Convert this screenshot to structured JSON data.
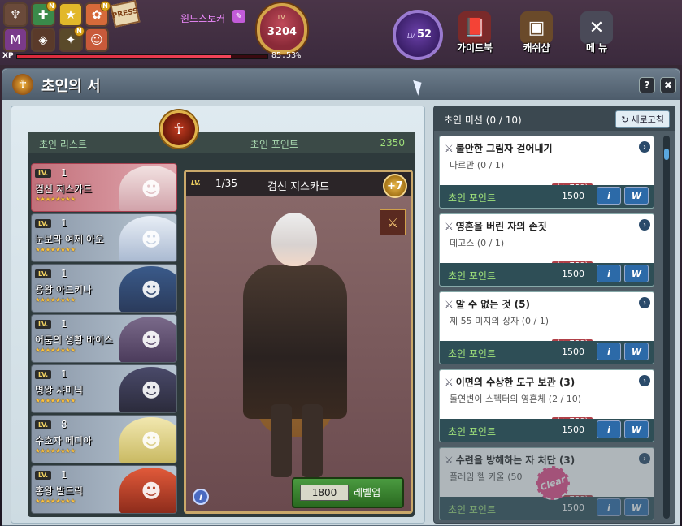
{
  "hud": {
    "character_name": "윈드스토커",
    "level_label": "LV.",
    "level_value": "3204",
    "xp_label": "XP",
    "xp_percent_text": "85.53%",
    "xp_fill": 0.8553,
    "press_label": "PRESS",
    "new_badge": "N",
    "account_level_label": "LV.",
    "account_level": "52",
    "menu": [
      {
        "label": "가이드북",
        "icon": "book-icon"
      },
      {
        "label": "캐쉬샵",
        "icon": "treasure-chest-icon"
      },
      {
        "label": "메 뉴",
        "icon": "crossed-tools-icon"
      }
    ]
  },
  "window": {
    "title": "초인의 서",
    "help_label": "?",
    "close_label": "✖"
  },
  "list": {
    "header_list": "초인 리스트",
    "header_points": "초인 포인트",
    "points_value": "2350",
    "lv_tag": "LV.",
    "stars": "★★★★★★★★",
    "items": [
      {
        "level": "1",
        "name": "검신 지스카드"
      },
      {
        "level": "1",
        "name": "눈보라 여제 아오"
      },
      {
        "level": "1",
        "name": "용왕 아드키나"
      },
      {
        "level": "1",
        "name": "어둠의 성황 바이스"
      },
      {
        "level": "1",
        "name": "명왕 샤미닉"
      },
      {
        "level": "8",
        "name": "수호자 메디아"
      },
      {
        "level": "1",
        "name": "홍왕 발드릭"
      }
    ]
  },
  "detail": {
    "lv_tag": "LV.",
    "progress": "1/35",
    "name": "검신 지스카드",
    "plus": "+7",
    "cost": "1800",
    "levelup_label": "레벨업",
    "info_label": "i"
  },
  "missions": {
    "header": "초인 미션 (0 / 10)",
    "refresh_label": "새로고침",
    "points_label": "초인 포인트",
    "info_label": "i",
    "w_label": "W",
    "clear_label": "Clear",
    "items": [
      {
        "title": "불안한 그림자 걷어내기",
        "sub": "다르만 (0 / 1)",
        "bonus": "(+ 750)",
        "points": "1500"
      },
      {
        "title": "영혼을 버린 자의 손짓",
        "sub": "데고스 (0 / 1)",
        "bonus": "(+ 750)",
        "points": "1500"
      },
      {
        "title": "알 수 없는 것 (5)",
        "sub": "제 55 미지의 상자 (0 / 1)",
        "bonus": "(+ 750)",
        "points": "1500"
      },
      {
        "title": "이면의 수상한 도구 보관 (3)",
        "sub": "돌연변이 스펙터의 영혼체 (2 / 10)",
        "bonus": "(+ 750)",
        "points": "1500"
      },
      {
        "title": "수련을 방해하는 자 처단 (3)",
        "sub": "플레임 헬 카울 (50",
        "bonus": "(+ 750)",
        "points": "1500"
      }
    ]
  }
}
